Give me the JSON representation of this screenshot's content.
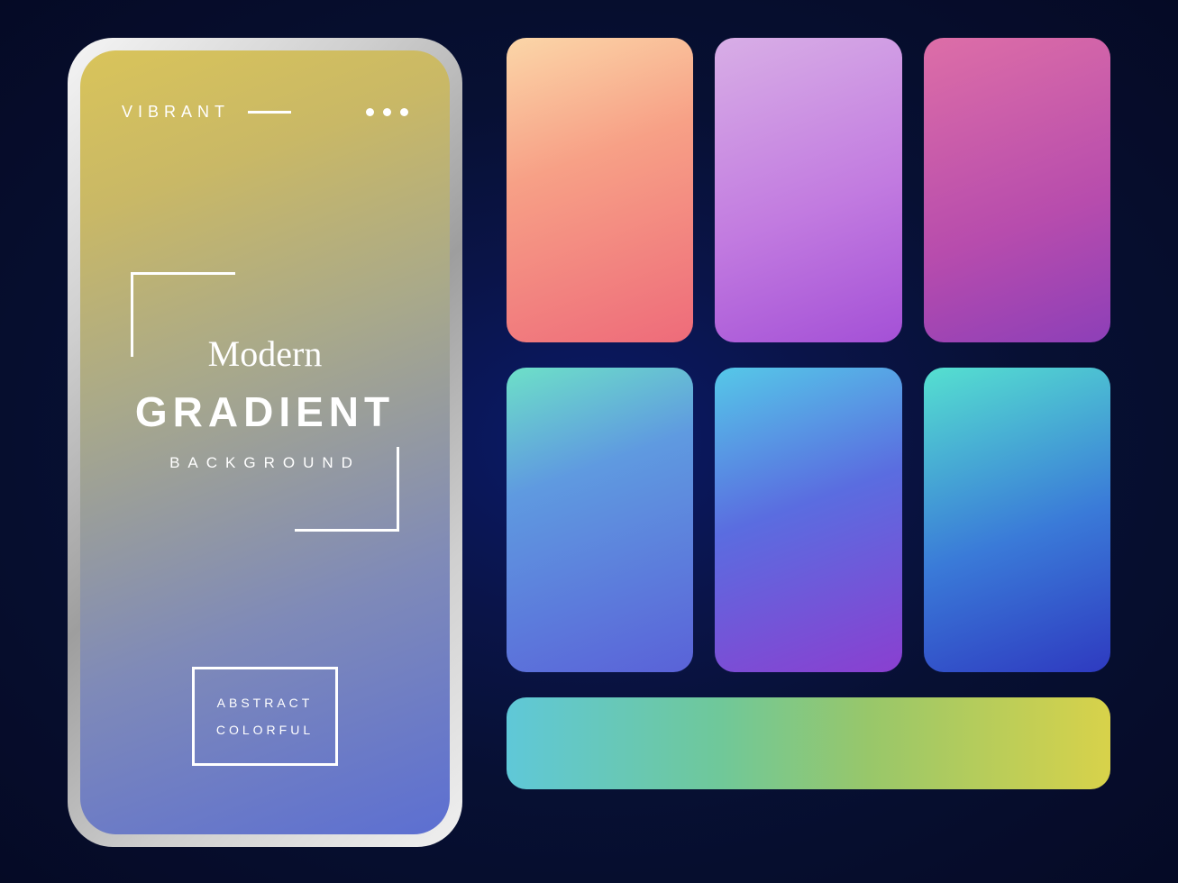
{
  "phone": {
    "top_label": "VIBRANT",
    "title": {
      "line1": "Modern",
      "line2": "GRADIENT",
      "line3": "BACKGROUND"
    },
    "abstract": {
      "line1": "ABSTRACT",
      "line2": "COLORFUL"
    },
    "gradient": {
      "from": "#d9c45a",
      "to": "#5c6fd2"
    }
  },
  "swatches": [
    {
      "name": "peach-coral",
      "from": "#fbd6a8",
      "to": "#ee6b7a"
    },
    {
      "name": "lilac-purple",
      "from": "#d8aee6",
      "to": "#a450d6"
    },
    {
      "name": "pink-magenta",
      "from": "#dd6ea7",
      "to": "#8d3fb8"
    },
    {
      "name": "teal-blue",
      "from": "#6de0c8",
      "to": "#5a62d8"
    },
    {
      "name": "cyan-violet",
      "from": "#55c8e8",
      "to": "#8a3fd0"
    },
    {
      "name": "aqua-navy",
      "from": "#55e0d0",
      "to": "#2e3ac0"
    }
  ],
  "bar": {
    "name": "teal-green-yellow",
    "from": "#5fc8d8",
    "to": "#d8d24a"
  }
}
